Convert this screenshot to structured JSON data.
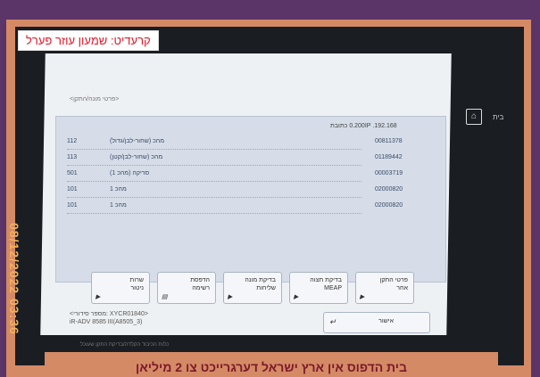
{
  "credit": "קרעדיט: שמעון עוזר פערל",
  "screen": {
    "path_label": "<פרטי מונה/התקן>",
    "address_label": "192.168. 0.200IP כתובת",
    "rows": [
      {
        "num": "112",
        "desc": "מהכ (שחור-לבן/גדול)",
        "code": "00811378"
      },
      {
        "num": "113",
        "desc": "מהכ (שחור-לבן/קטן)",
        "code": "01189442"
      },
      {
        "num": "501",
        "desc": "סריקה (מהכ 1)",
        "code": "00003719"
      },
      {
        "num": "101",
        "desc": "מהכ 1",
        "code": "02000820"
      },
      {
        "num": "101",
        "desc": "מהכ 1",
        "code": "02000820"
      }
    ],
    "buttons": [
      {
        "label": "פרטי התקן\nאחר"
      },
      {
        "label": "בדיקת תצוה\nMEAP"
      },
      {
        "label": "בדיקת מונה\nשליחות"
      },
      {
        "label": "הדפסת\nרשימה"
      },
      {
        "label": "שרות\nניטור"
      }
    ],
    "info_line1": "<מספר סידורי: XYCR01840>",
    "info_line2": "iR-ADV 8585 III(A8505_3)",
    "ok_label": "אישור",
    "home_label": "בית",
    "bottom_text": "כלות הכיבוד הקלדה/בדיקת התקן שעוכל"
  },
  "date_stamp": "08/12/2022 03:36",
  "caption": "בית הדפוס אין ארץ ישראל דערגרייכט צו 2 מיליאן"
}
